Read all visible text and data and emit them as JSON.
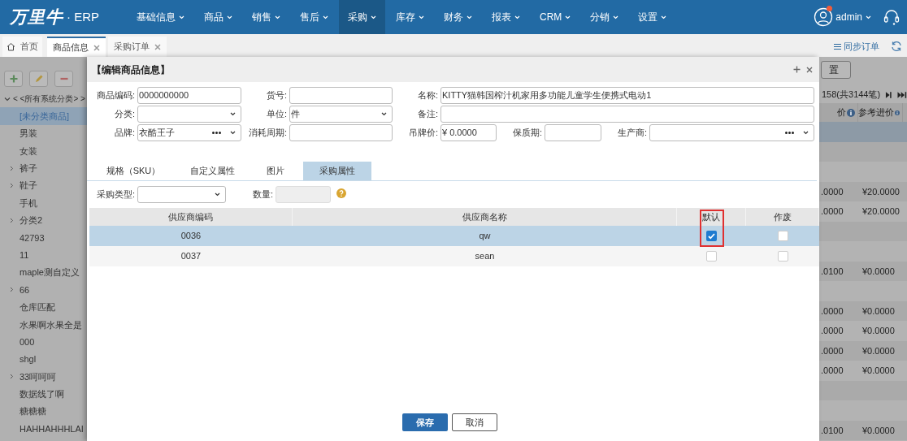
{
  "nav": {
    "logo": "万里牛",
    "logo_suffix": "· ERP",
    "menus": [
      {
        "label": "基础信息",
        "selected": false
      },
      {
        "label": "商品",
        "selected": false
      },
      {
        "label": "销售",
        "selected": false
      },
      {
        "label": "售后",
        "selected": false
      },
      {
        "label": "采购",
        "selected": true
      },
      {
        "label": "库存",
        "selected": false
      },
      {
        "label": "财务",
        "selected": false
      },
      {
        "label": "报表",
        "selected": false
      },
      {
        "label": "CRM",
        "selected": false
      },
      {
        "label": "分销",
        "selected": false
      },
      {
        "label": "设置",
        "selected": false
      }
    ],
    "user": "admin",
    "notification": true
  },
  "tabs": [
    {
      "label": "首页",
      "kind": "home",
      "selected": false
    },
    {
      "label": "商品信息",
      "kind": "closable",
      "selected": true
    },
    {
      "label": "采购订单",
      "kind": "closable",
      "selected": false
    }
  ],
  "tab_actions": {
    "sync": "同步订单"
  },
  "sidebar": {
    "tree": {
      "label": "< <所有系统分类> >",
      "expanded": true,
      "children": [
        {
          "label": "[未分类商品]",
          "selected": true,
          "expandable": false
        },
        {
          "label": "男装",
          "selected": false,
          "expandable": false
        },
        {
          "label": "女装",
          "selected": false,
          "expandable": false
        },
        {
          "label": "裤子",
          "selected": false,
          "expandable": true
        },
        {
          "label": "鞋子",
          "selected": false,
          "expandable": true
        },
        {
          "label": "手机",
          "selected": false,
          "expandable": false
        },
        {
          "label": "分类2",
          "selected": false,
          "expandable": true
        },
        {
          "label": "42793",
          "selected": false,
          "expandable": false
        },
        {
          "label": "11",
          "selected": false,
          "expandable": false
        },
        {
          "label": "maple测自定义",
          "selected": false,
          "expandable": false
        },
        {
          "label": "66",
          "selected": false,
          "expandable": true
        },
        {
          "label": "仓库匹配",
          "selected": false,
          "expandable": false
        },
        {
          "label": "水果啊水果全是",
          "selected": false,
          "expandable": false
        },
        {
          "label": "000",
          "selected": false,
          "expandable": false
        },
        {
          "label": "shgl",
          "selected": false,
          "expandable": false
        },
        {
          "label": "33呵呵呵",
          "selected": false,
          "expandable": true
        },
        {
          "label": "数据线了啊",
          "selected": false,
          "expandable": false
        },
        {
          "label": "糖糖糖",
          "selected": false,
          "expandable": false
        },
        {
          "label": "HAHHAHHHLAI",
          "selected": false,
          "expandable": false
        }
      ]
    }
  },
  "list_panel": {
    "reset_button": "置",
    "pager": "158(共3144笔)",
    "columns": [
      {
        "label": "价",
        "info": true
      },
      {
        "label": "参考进价",
        "info": true
      }
    ],
    "rows": [
      {
        "selected": true
      },
      {
        "selected": false
      },
      {
        "selected": false
      },
      {
        "selected": false,
        "column_1": ".0000",
        "column_2": "¥20.0000"
      },
      {
        "selected": false,
        "column_1": ".0000",
        "column_2": "¥20.0000"
      },
      {
        "selected": false
      },
      {
        "selected": false
      },
      {
        "selected": false,
        "column_1": ".0100",
        "column_2": "¥0.0000"
      },
      {
        "selected": false
      },
      {
        "selected": false,
        "column_1": ".0000",
        "column_2": "¥0.0000"
      },
      {
        "selected": false,
        "column_1": ".0000",
        "column_2": "¥0.0000"
      },
      {
        "selected": false,
        "column_1": ".0000",
        "column_2": "¥0.0000"
      },
      {
        "selected": false,
        "column_1": ".0000",
        "column_2": "¥0.0000"
      },
      {
        "selected": false
      },
      {
        "selected": false
      },
      {
        "selected": false,
        "column_1": ".0100",
        "column_2": "¥0.0000"
      }
    ]
  },
  "dialog": {
    "title": "【编辑商品信息】",
    "field_rows": [
      [
        {
          "label": "商品编码:",
          "kind": "text",
          "value": "0000000000"
        },
        {
          "label": "货号:",
          "kind": "text"
        },
        {
          "label": "名称:",
          "kind": "text",
          "value": "KITTY猫韩国榨汁机家用多功能儿童学生便携式电动1"
        }
      ],
      [
        {
          "label": "分类:",
          "kind": "select"
        },
        {
          "label": "单位:",
          "kind": "select",
          "value": "件"
        },
        {
          "label": "备注:",
          "kind": "text"
        }
      ],
      [
        {
          "label": "品牌:",
          "kind": "picker",
          "value": "衣酷王子"
        },
        {
          "label": "消耗周期:",
          "kind": "text"
        },
        {
          "label": "吊牌价:",
          "kind": "text",
          "value": "¥ 0.0000"
        },
        {
          "label": "保质期:",
          "kind": "text"
        },
        {
          "label": "生产商:",
          "kind": "picker"
        }
      ]
    ],
    "tabs": [
      {
        "label": "规格（SKU）",
        "selected": false
      },
      {
        "label": "自定义属性",
        "selected": false
      },
      {
        "label": "图片",
        "selected": false
      },
      {
        "label": "采购属性",
        "selected": true
      }
    ],
    "purchase_type": {
      "label": "采购类型:"
    },
    "quantity": {
      "label": "数量:",
      "disabled": true
    },
    "table": {
      "columns": [
        {
          "label": "供应商编码",
          "highlighted": false
        },
        {
          "label": "供应商名称",
          "highlighted": false
        },
        {
          "label": "默认",
          "highlighted": true
        },
        {
          "label": "作废",
          "highlighted": false
        }
      ],
      "rows": [
        {
          "selected": true,
          "code": "0036",
          "name": "qw",
          "default": true,
          "void": false
        },
        {
          "selected": false,
          "code": "0037",
          "name": "sean",
          "default": false,
          "void": false
        }
      ]
    },
    "buttons": [
      {
        "label": "保存",
        "kind": "primary"
      },
      {
        "label": "取消",
        "kind": "secondary"
      }
    ]
  }
}
